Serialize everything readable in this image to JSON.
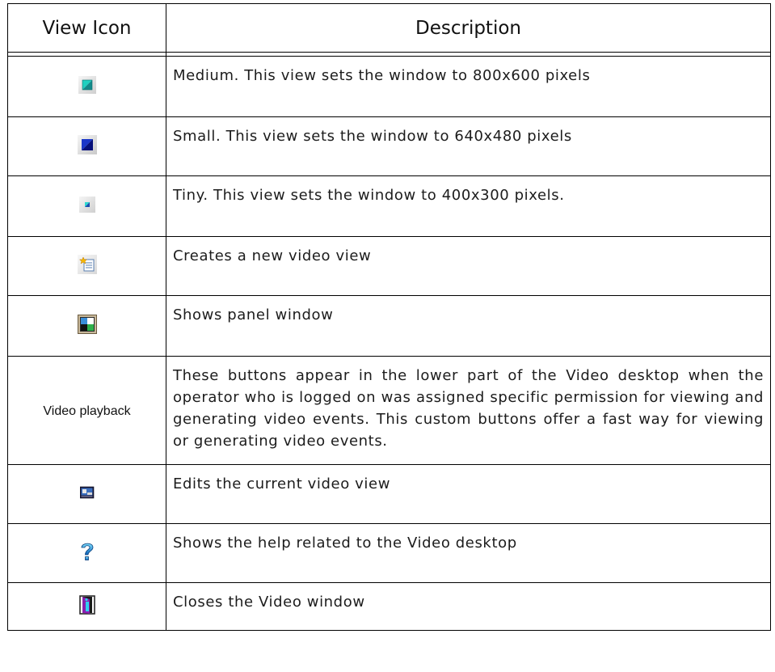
{
  "header": {
    "col_icon": "View Icon",
    "col_desc": "Description"
  },
  "rows": [
    {
      "icon": "medium-view-icon",
      "icon_label": "",
      "description": "Medium. This view sets the window to 800x600 pixels"
    },
    {
      "icon": "small-view-icon",
      "icon_label": "",
      "description": "Small. This view sets the window to 640x480 pixels"
    },
    {
      "icon": "tiny-view-icon",
      "icon_label": "",
      "description": "Tiny. This view sets the window to 400x300 pixels."
    },
    {
      "icon": "new-video-view-icon",
      "icon_label": "",
      "description": "Creates a new video view"
    },
    {
      "icon": "panel-window-icon",
      "icon_label": "",
      "description": "Shows panel window"
    },
    {
      "icon": "",
      "icon_label": "Video playback",
      "description": "These buttons appear in the lower part of the Video desktop when the operator who is logged on was assigned specific permission for viewing and generating video events. This custom buttons offer a fast way for viewing or generating video events."
    },
    {
      "icon": "edit-video-view-icon",
      "icon_label": "",
      "description": "Edits the current video view"
    },
    {
      "icon": "help-icon",
      "icon_label": "",
      "description": "Shows the help related to the Video desktop"
    },
    {
      "icon": "close-video-window-icon",
      "icon_label": "",
      "description": "Closes the Video window"
    }
  ],
  "colors": {
    "teal": "#1fbfb0",
    "navy": "#0a1e9a",
    "help_blue": "#1f8fd6",
    "exit_purple": "#7a1fa0"
  }
}
